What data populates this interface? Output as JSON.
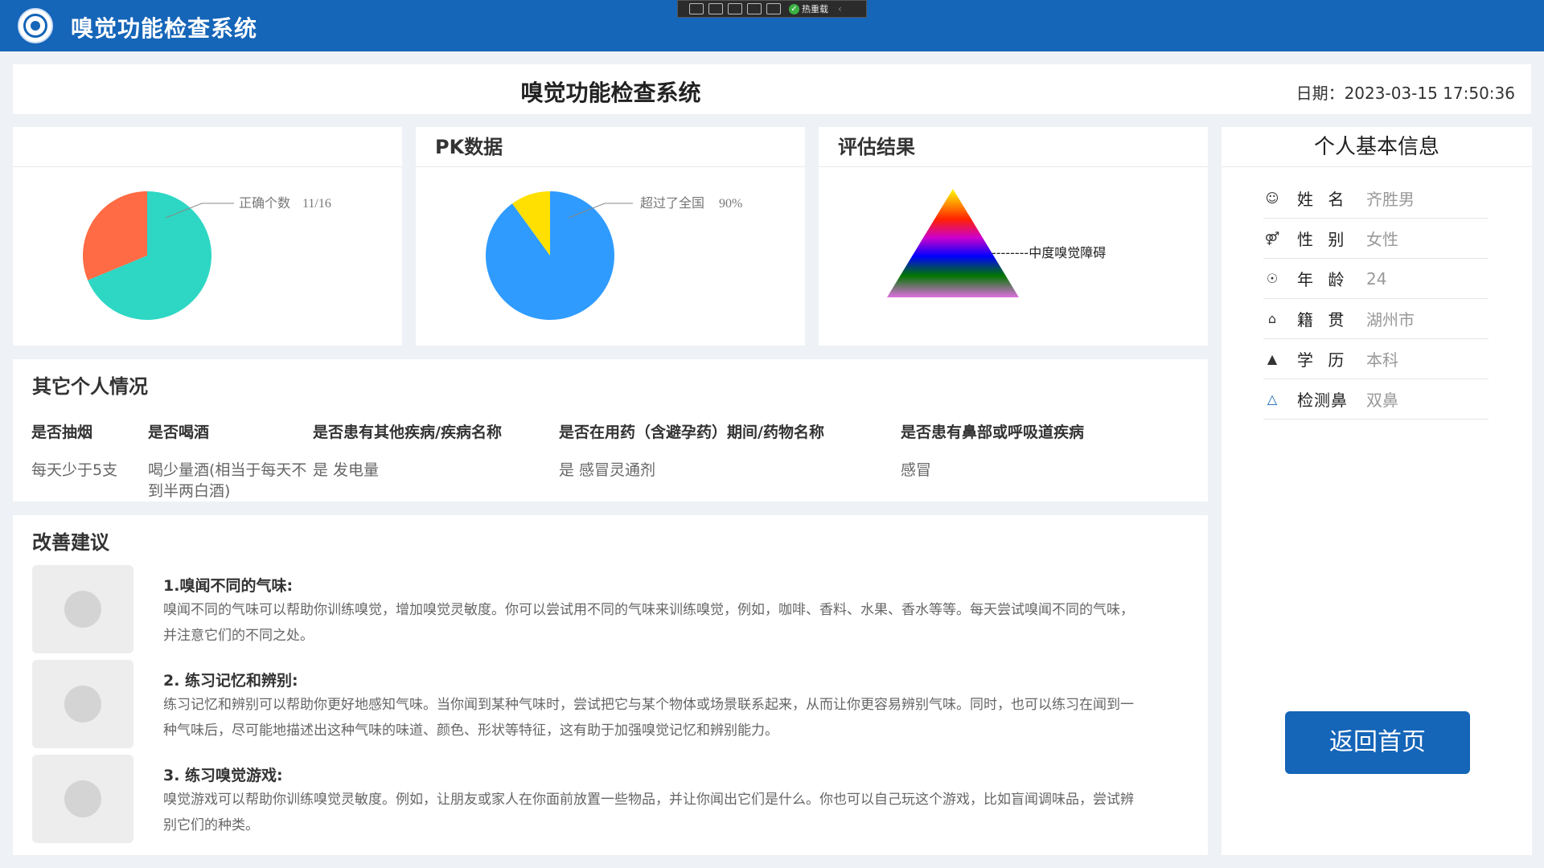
{
  "app": {
    "title": "嗅觉功能检查系统"
  },
  "devtoolbar": {
    "hot_reload_label": "热重载"
  },
  "header": {
    "title": "嗅觉功能检查系统",
    "date_label": "日期：2023-03-15 17:50:36"
  },
  "panels": {
    "correct": {
      "title": "",
      "label": "正确个数",
      "value_text": "11/16",
      "correct": 11,
      "total": 16,
      "colors": {
        "correct": "#2dd7c4",
        "wrong": "#ff6b44"
      }
    },
    "pk": {
      "title": "PK数据",
      "label": "超过了全国",
      "value_text": "90%",
      "percent": 90,
      "colors": {
        "main": "#2f9bff",
        "rest": "#ffe000"
      }
    },
    "assessment": {
      "title": "评估结果",
      "result": "--------中度嗅觉障碍"
    }
  },
  "personal": {
    "title": "个人基本信息",
    "rows": [
      {
        "icon": "user-icon",
        "label": "姓 名",
        "value": "齐胜男"
      },
      {
        "icon": "gender-icon",
        "label": "性 别",
        "value": "女性"
      },
      {
        "icon": "age-icon",
        "label": "年 龄",
        "value": "24"
      },
      {
        "icon": "home-icon",
        "label": "籍 贯",
        "value": "湖州市"
      },
      {
        "icon": "graduation-cap-icon",
        "label": "学 历",
        "value": "本科"
      },
      {
        "icon": "nose-icon",
        "label": "检测鼻",
        "value": "双鼻"
      }
    ]
  },
  "other": {
    "title": "其它个人情况",
    "columns": [
      {
        "header": "是否抽烟",
        "value": "每天少于5支"
      },
      {
        "header": "是否喝酒",
        "value": "喝少量酒(相当于每天不到半两白酒)"
      },
      {
        "header": "是否患有其他疾病/疾病名称",
        "value": "是 发电量"
      },
      {
        "header": "是否在用药（含避孕药）期间/药物名称",
        "value": "是 感冒灵通剂"
      },
      {
        "header": "是否患有鼻部或呼吸道疾病",
        "value": "感冒"
      }
    ]
  },
  "advice": {
    "title": "改善建议",
    "items": [
      {
        "icon": "smell-icon",
        "heading": "1.嗅闻不同的气味:",
        "text": "嗅闻不同的气味可以帮助你训练嗅觉，增加嗅觉灵敏度。你可以尝试用不同的气味来训练嗅觉，例如，咖啡、香料、水果、香水等等。每天尝试嗅闻不同的气味，并注意它们的不同之处。"
      },
      {
        "icon": "brain-icon",
        "heading": "2. 练习记忆和辨别:",
        "text": "练习记忆和辨别可以帮助你更好地感知气味。当你闻到某种气味时，尝试把它与某个物体或场景联系起来，从而让你更容易辨别气味。同时，也可以练习在闻到一种气味后，尽可能地描述出这种气味的味道、颜色、形状等特征，这有助于加强嗅觉记忆和辨别能力。"
      },
      {
        "icon": "game-icon",
        "heading": "3. 练习嗅觉游戏:",
        "text": "嗅觉游戏可以帮助你训练嗅觉灵敏度。例如，让朋友或家人在你面前放置一些物品，并让你闻出它们是什么。你也可以自己玩这个游戏，比如盲闻调味品，尝试辨别它们的种类。"
      }
    ]
  },
  "buttons": {
    "home": "返回首页"
  }
}
